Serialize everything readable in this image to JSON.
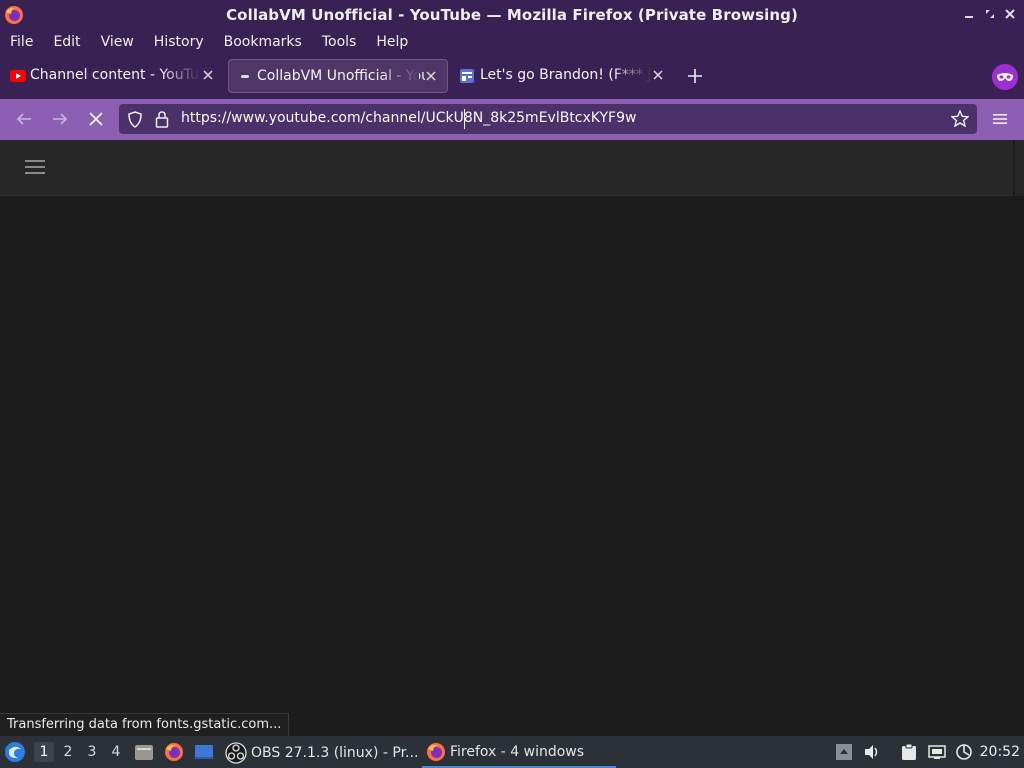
{
  "window": {
    "title": "CollabVM Unofficial - YouTube — Mozilla Firefox (Private Browsing)"
  },
  "menu": {
    "items": [
      "File",
      "Edit",
      "View",
      "History",
      "Bookmarks",
      "Tools",
      "Help"
    ]
  },
  "tabs": [
    {
      "label": "Channel content - YouTube",
      "favicon": "youtube-icon",
      "active": false
    },
    {
      "label": "CollabVM Unofficial - YouTube",
      "favicon": "loading-icon",
      "active": true
    },
    {
      "label": "Let's go Brandon! (F*** Joe",
      "favicon": "page-icon",
      "active": false
    }
  ],
  "navbar": {
    "url": "https://www.youtube.com/channel/UCkU8N_8k25mEvlBtcxKYF9w"
  },
  "status": {
    "text": "Transferring data from fonts.gstatic.com..."
  },
  "taskbar": {
    "workspaces": [
      "1",
      "2",
      "3",
      "4"
    ],
    "windows": [
      {
        "label": "OBS 27.1.3 (linux) - Pr..."
      },
      {
        "label": "Firefox - 4 windows"
      }
    ],
    "clock": "20:52"
  },
  "colors": {
    "titlebar": "#3a2153",
    "navbar": "#8c5fb3",
    "urlbar": "#4c306a",
    "page_bg": "#1c1c1c",
    "taskbar": "#2c3037",
    "accent": "#4a86d8"
  }
}
